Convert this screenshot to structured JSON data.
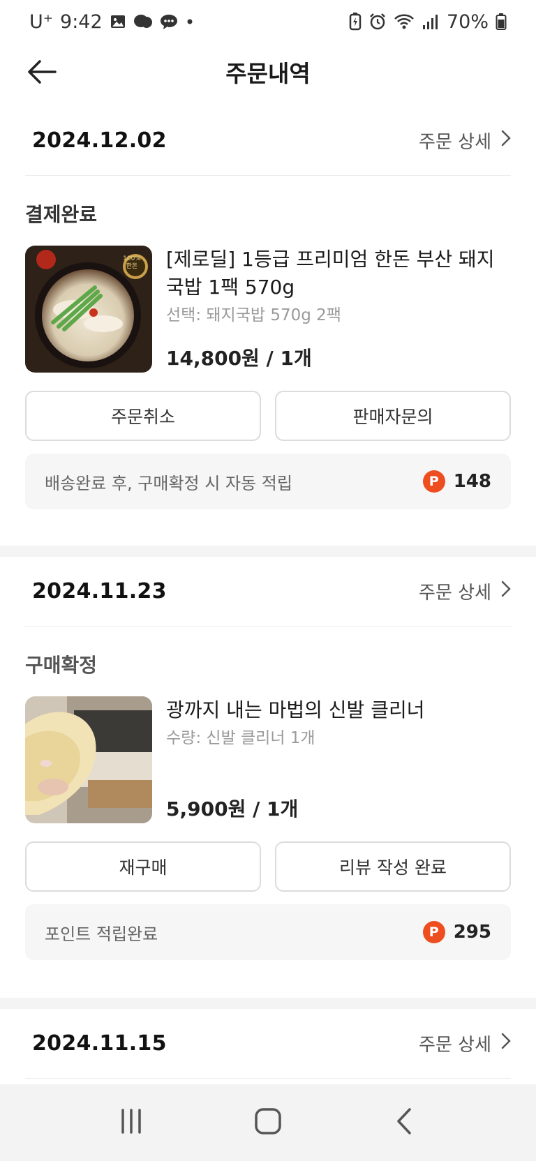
{
  "status_bar": {
    "carrier": "U⁺",
    "time": "9:42",
    "battery": "70%",
    "icons_left": [
      "gallery-icon",
      "messenger-icon",
      "chat-bubble-icon",
      "dot-icon"
    ],
    "icons_right": [
      "battery-saver-icon",
      "alarm-icon",
      "wifi-icon",
      "signal-icon",
      "battery-icon"
    ]
  },
  "header": {
    "title": "주문내역",
    "back_icon": "arrow-left-icon"
  },
  "orders": [
    {
      "date": "2024.12.02",
      "detail_label": "주문 상세",
      "status": "결제완료",
      "product_name": "[제로딜] 1등급 프리미엄 한돈 부산 돼지국밥 1팩 570g",
      "option": "선택: 돼지국밥 570g 2팩",
      "price": "14,800원 / 1개",
      "thumb_badge_top": "100%",
      "thumb_badge_bottom": "한돈",
      "buttons": [
        "주문취소",
        "판매자문의"
      ],
      "point_text": "배송완료 후, 구매확정 시 자동 적립",
      "point_badge": "P",
      "point_value": "148"
    },
    {
      "date": "2024.11.23",
      "detail_label": "주문 상세",
      "status": "구매확정",
      "product_name": "광까지 내는 마법의 신발 클리너",
      "option": "수량: 신발 클리너 1개",
      "price": "5,900원 / 1개",
      "buttons": [
        "재구매",
        "리뷰 작성 완료"
      ],
      "point_text": "포인트 적립완료",
      "point_badge": "P",
      "point_value": "295"
    },
    {
      "date": "2024.11.15",
      "detail_label": "주문 상세"
    }
  ],
  "navbar": {
    "items": [
      "recent-apps-icon",
      "home-icon",
      "back-icon"
    ]
  },
  "colors": {
    "point_badge": "#ee4d1f",
    "point_box_bg": "#f6f6f6",
    "divider": "#f4f4f4",
    "navbar_bg": "#f3f3f3"
  }
}
